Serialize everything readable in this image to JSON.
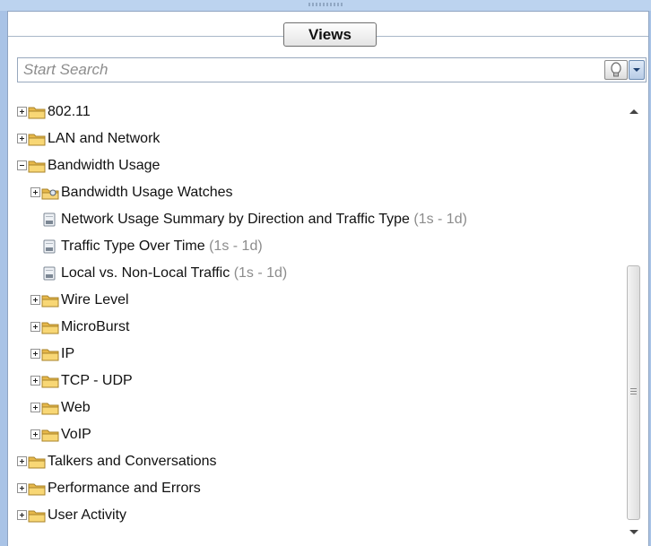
{
  "header": {
    "tab_label": "Views"
  },
  "search": {
    "placeholder": "Start Search",
    "value": ""
  },
  "tree": [
    {
      "label": "802.11",
      "range": "",
      "type": "folder",
      "expander": "plus",
      "level": 0
    },
    {
      "label": "LAN and Network",
      "range": "",
      "type": "folder",
      "expander": "plus",
      "level": 0
    },
    {
      "label": "Bandwidth Usage",
      "range": "",
      "type": "folder",
      "expander": "minus",
      "level": 0
    },
    {
      "label": "Bandwidth Usage Watches",
      "range": "",
      "type": "watch-folder",
      "expander": "plus",
      "level": 1
    },
    {
      "label": "Network Usage Summary by Direction and Traffic Type",
      "range": "(1s - 1d)",
      "type": "report",
      "expander": "",
      "level": 1
    },
    {
      "label": "Traffic Type Over Time",
      "range": "(1s - 1d)",
      "type": "report",
      "expander": "",
      "level": 1
    },
    {
      "label": "Local vs. Non-Local Traffic",
      "range": "(1s - 1d)",
      "type": "report",
      "expander": "",
      "level": 1
    },
    {
      "label": "Wire Level",
      "range": "",
      "type": "folder",
      "expander": "plus",
      "level": 1
    },
    {
      "label": "MicroBurst",
      "range": "",
      "type": "folder",
      "expander": "plus",
      "level": 1
    },
    {
      "label": "IP",
      "range": "",
      "type": "folder",
      "expander": "plus",
      "level": 1
    },
    {
      "label": "TCP - UDP",
      "range": "",
      "type": "folder",
      "expander": "plus",
      "level": 1
    },
    {
      "label": "Web",
      "range": "",
      "type": "folder",
      "expander": "plus",
      "level": 1
    },
    {
      "label": "VoIP",
      "range": "",
      "type": "folder",
      "expander": "plus",
      "level": 1
    },
    {
      "label": "Talkers and Conversations",
      "range": "",
      "type": "folder",
      "expander": "plus",
      "level": 0
    },
    {
      "label": "Performance and Errors",
      "range": "",
      "type": "folder",
      "expander": "plus",
      "level": 0
    },
    {
      "label": "User Activity",
      "range": "",
      "type": "folder",
      "expander": "plus",
      "level": 0
    }
  ],
  "icons": {
    "folder": "folder-icon",
    "watch-folder": "watch-folder-icon",
    "report": "report-icon",
    "search": "search-bulb-icon",
    "dropdown": "dropdown-arrow-icon"
  },
  "colors": {
    "folder": "#f2c94c",
    "range_text": "#8c8c8c",
    "frame": "#a9c3e6"
  }
}
